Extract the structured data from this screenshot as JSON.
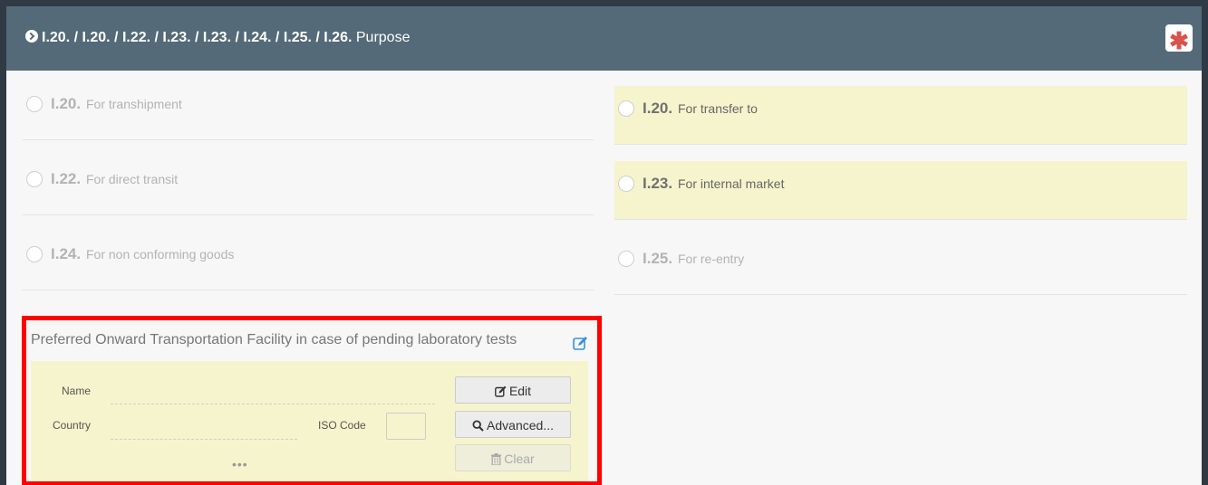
{
  "header": {
    "codes": "I.20. / I.20. / I.22. / I.23. / I.23. / I.24. / I.25. / I.26.",
    "title": "Purpose",
    "required_icon": "asterisk-icon",
    "expand_icon": "chevron-circle-right-icon"
  },
  "options": [
    {
      "code": "I.20.",
      "label": "For transhipment",
      "highlighted": false
    },
    {
      "code": "I.20.",
      "label": "For transfer to",
      "highlighted": true
    },
    {
      "code": "I.22.",
      "label": "For direct transit",
      "highlighted": false
    },
    {
      "code": "I.23.",
      "label": "For internal market",
      "highlighted": true
    },
    {
      "code": "I.24.",
      "label": "For non conforming goods",
      "highlighted": false
    },
    {
      "code": "I.25.",
      "label": "For re-entry",
      "highlighted": false
    }
  ],
  "facility": {
    "title": "Preferred Onward Transportation Facility in case of pending laboratory tests",
    "name_label": "Name",
    "country_label": "Country",
    "iso_label": "ISO Code",
    "more": "•••",
    "edit_label": "Edit",
    "advanced_label": "Advanced...",
    "clear_label": "Clear"
  },
  "colors": {
    "header_bg": "#546a78",
    "highlight_bg": "#f6f4cc",
    "focus_border": "#ff0000",
    "required": "#d9534f",
    "link_blue": "#3a8fd9"
  }
}
